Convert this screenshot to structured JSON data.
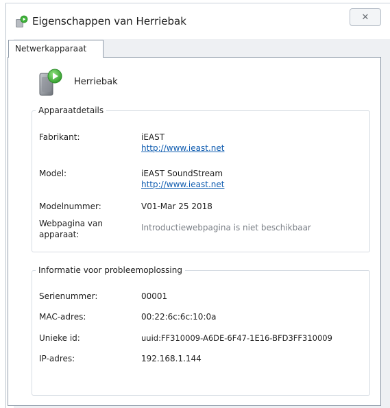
{
  "window": {
    "title": "Eigenschappen van Herriebak",
    "close_glyph": "✕",
    "title_icon": "device-properties-icon"
  },
  "tabs": [
    {
      "label": "Netwerkapparaat",
      "selected": true
    }
  ],
  "device": {
    "name": "Herriebak",
    "icon": "media-device-play-icon"
  },
  "details": {
    "legend": "Apparaatdetails",
    "manufacturer": {
      "label": "Fabrikant:",
      "value": "iEAST",
      "link": "http://www.ieast.net"
    },
    "model": {
      "label": "Model:",
      "value": "iEAST SoundStream",
      "link": "http://www.ieast.net"
    },
    "model_number": {
      "label": "Modelnummer:",
      "value": "V01-Mar 25 2018"
    },
    "webpage": {
      "label_line1": "Webpagina van",
      "label_line2": "apparaat:",
      "value": "Introductiewebpagina is niet beschikbaar"
    }
  },
  "troubleshooting": {
    "legend": "Informatie voor probleemoplossing",
    "serial": {
      "label": "Serienummer:",
      "value": "00001"
    },
    "mac": {
      "label": "MAC-adres:",
      "value": "00:22:6c:6c:10:0a"
    },
    "uuid": {
      "label": "Unieke id:",
      "value": "uuid:FF310009-A6DE-6F47-1E16-BFD3FF310009"
    },
    "ip": {
      "label": "IP-adres:",
      "value": "192.168.1.144"
    }
  },
  "colors": {
    "link": "#0f5cb0",
    "muted_text": "#7a7f86",
    "dialog_background": "#eef0f3",
    "border": "#8e9aa8",
    "device_icon_green": "#3fb33a"
  }
}
